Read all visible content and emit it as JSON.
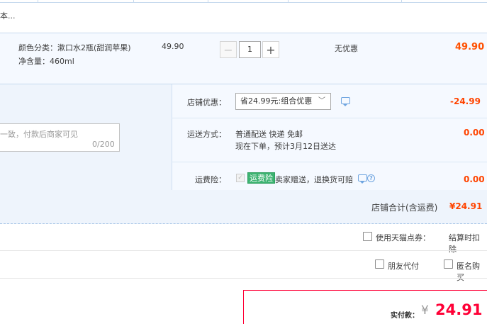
{
  "item": {
    "title_fragment": "本...",
    "attr_color": "颜色分类：漱口水2瓶(甜润苹果)",
    "attr_volume": "净含量：460ml",
    "unit_price": "49.90",
    "quantity": "1",
    "qty_minus": "−",
    "qty_plus": "+",
    "discount": "无优惠",
    "total": "49.90"
  },
  "message": {
    "placeholder": "一致，付款后商家可见",
    "counter": "0/200"
  },
  "shop_discount": {
    "label": "店铺优惠：",
    "selected": "省24.99元:组合优惠",
    "value": "-24.99"
  },
  "shipping": {
    "label": "运送方式：",
    "method": "普通配送 快递 免邮",
    "eta": "现在下单，预计3月12日送达",
    "value": "0.00"
  },
  "insurance": {
    "label": "运费险：",
    "badge": "运费险",
    "desc": "卖家赠送，退换货可赔",
    "value": "0.00"
  },
  "shop_total": {
    "label": "店铺合计(含运费)",
    "value": "¥24.91"
  },
  "options": {
    "tmall_points": "使用天猫点券：",
    "tmall_points_note": "结算时扣除",
    "friend_pay": "朋友代付",
    "anonymous": "匿名购买"
  },
  "payment": {
    "label": "实付款：",
    "currency": "¥",
    "amount": "24.91"
  },
  "colors": {
    "accent_red": "#ff0036",
    "price_orange": "#ff5000",
    "border_blue": "#c6d9ee"
  }
}
